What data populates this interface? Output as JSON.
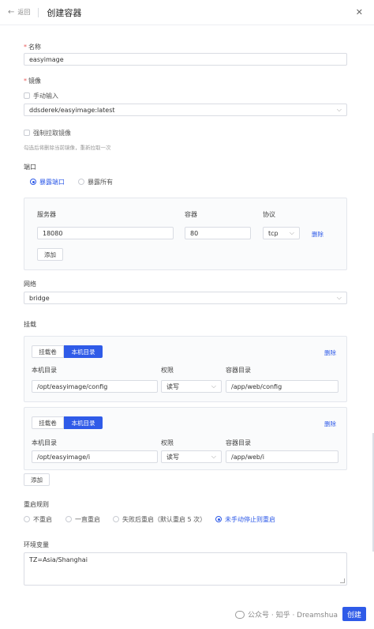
{
  "header": {
    "back_label": "返回",
    "title": "创建容器",
    "close_symbol": "✕"
  },
  "name_section": {
    "label": "名称",
    "value": "easyimage"
  },
  "image_section": {
    "label": "镜像",
    "manual_input_label": "手动输入",
    "selected_image": "ddsderek/easyimage:latest",
    "force_pull_label": "强制拉取镜像",
    "force_pull_hint": "勾选后将删除当前镜像，重新拉取一次"
  },
  "ports_section": {
    "label": "端口",
    "mode_options": [
      "暴露端口",
      "暴露所有"
    ],
    "selected_mode": "暴露端口",
    "columns": [
      "服务器",
      "容器",
      "协议"
    ],
    "rows": [
      {
        "host": "18080",
        "container": "80",
        "protocol": "tcp",
        "delete_label": "删除"
      }
    ],
    "add_label": "添加"
  },
  "network_section": {
    "label": "网络",
    "value": "bridge"
  },
  "mounts_section": {
    "label": "挂载",
    "type_options": [
      "挂载卷",
      "本机目录"
    ],
    "columns": [
      "本机目录",
      "权限",
      "容器目录"
    ],
    "mounts": [
      {
        "active_type": "本机目录",
        "host_dir": "/opt/easyimage/config",
        "permission": "读写",
        "container_dir": "/app/web/config",
        "delete_label": "删除"
      },
      {
        "active_type": "本机目录",
        "host_dir": "/opt/easyimage/i",
        "permission": "读写",
        "container_dir": "/app/web/i",
        "delete_label": "删除"
      }
    ],
    "add_label": "添加"
  },
  "restart_section": {
    "label": "重启规则",
    "options": [
      "不重启",
      "一直重启",
      "失败后重启（默认重启 5 次）",
      "未手动停止则重启"
    ],
    "selected": "未手动停止则重启"
  },
  "env_section": {
    "label": "环境变量",
    "value": "TZ=Asia/Shanghai"
  },
  "footer": {
    "watermark": "公众号 · 知乎 · Dreamshua",
    "submit_label": "创建"
  },
  "colors": {
    "accent": "#2f5be8",
    "required": "#e85c5c"
  }
}
